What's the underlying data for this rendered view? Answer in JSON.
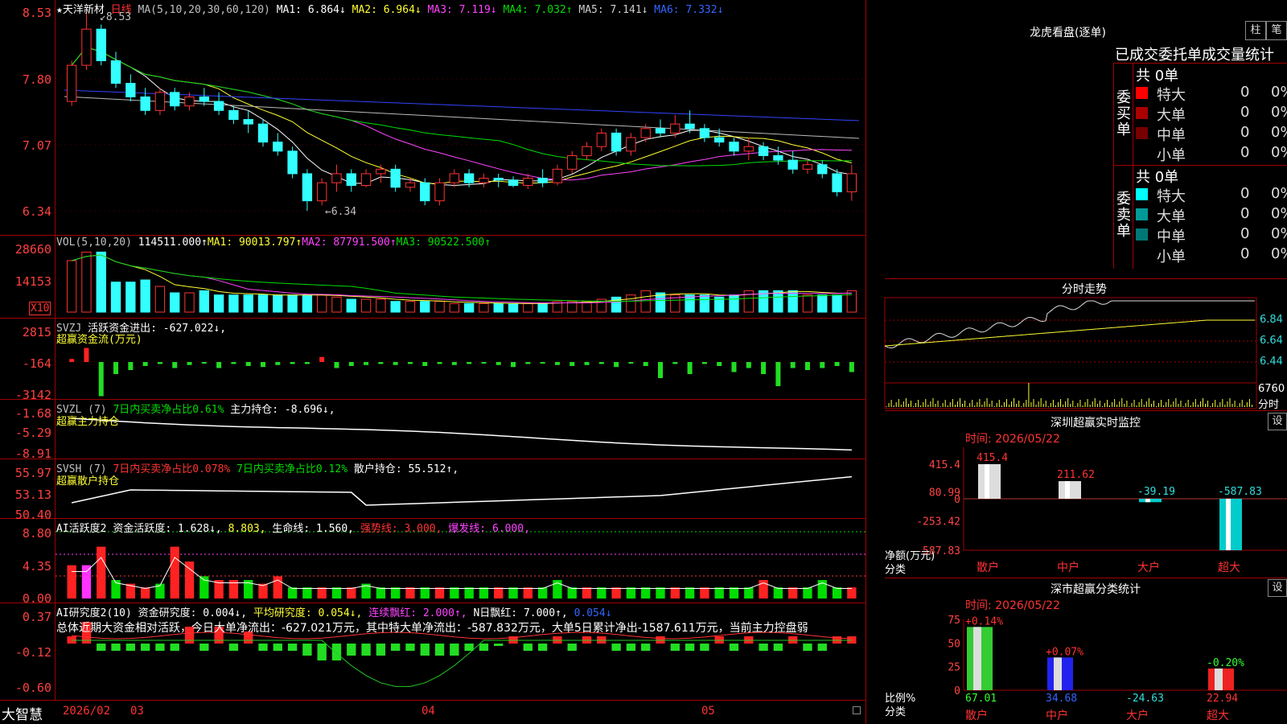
{
  "stock": {
    "name_label": "★天洋新材",
    "period": "日线"
  },
  "main_ma": {
    "title": "MA(5,10,20,30,60,120)",
    "items": [
      {
        "t": "MA1: 6.864↓",
        "c": "#ffffff"
      },
      {
        "t": "MA2: 6.964↓",
        "c": "#ffff33"
      },
      {
        "t": "MA3: 7.119↓",
        "c": "#ff44ff"
      },
      {
        "t": "MA4: 7.032↑",
        "c": "#00dd00"
      },
      {
        "t": "MA5: 7.141↓",
        "c": "#cccccc"
      },
      {
        "t": "MA6: 7.332↓",
        "c": "#3366ff"
      }
    ]
  },
  "main_axis": [
    "8.53",
    "7.80",
    "7.07",
    "6.34"
  ],
  "high_note": "8.53",
  "low_note": "←6.34",
  "vol": {
    "title": "VOL(5,10,20)",
    "v": "114511.000↑",
    "ma1": "MA1: 90013.797↑",
    "ma2": "MA2: 87791.500↑",
    "ma3": "MA3: 90522.500↑",
    "axis": [
      "28660",
      "14153"
    ],
    "unit": "X10"
  },
  "svzj": {
    "title": "SVZJ",
    "label": "活跃资金进出: -627.022↓,",
    "sub": "超赢资金流(万元)",
    "axis": [
      "2815",
      "-164",
      "-3142"
    ]
  },
  "svzl": {
    "title": "SVZL (7)",
    "a": "7日内买卖净占比0.61%",
    "b": "主力持仓: -8.696↓,",
    "sub": "超赢主力持仓",
    "axis": [
      "-1.68",
      "-5.29",
      "-8.91"
    ]
  },
  "svsh": {
    "title": "SVSH (7)",
    "a": "7日内买卖净占比0.078%",
    "b": "7日内买卖净占比0.12%",
    "c": "散户持仓: 55.512↑,",
    "sub": "超赢散户持仓",
    "axis": [
      "55.97",
      "53.13",
      "50.40"
    ]
  },
  "ai1": {
    "title": "AI活跃度2",
    "a": "资金活跃度: 1.628↓,",
    "b": "8.803,",
    "c": "生命线: 1.560,",
    "d": "强势线: 3.000,",
    "e": "爆发线: 6.000,",
    "axis": [
      "8.80",
      "4.35",
      "0.00"
    ]
  },
  "ai2": {
    "title": "AI研究度2(10)",
    "a": "资金研究度: 0.004↓,",
    "b": "平均研究度: 0.054↓,",
    "c": "连续飘红: 2.000↑,",
    "d": "N日飘红: 7.000↑,",
    "e": "0.054↓",
    "summary": "总体近期大资金相对活跃，今日大单净流出：-627.021万元，其中特大单净流出：-587.832万元，大单5日累计净出-1587.611万元，当前主力控盘弱",
    "axis": [
      "0.37",
      "-0.12",
      "-0.60"
    ]
  },
  "xaxis": {
    "brand": "大智慧",
    "d1": "2026/02",
    "d2": "03",
    "d3": "04",
    "d4": "05"
  },
  "right": {
    "dragon_title": "龙虎看盘(逐单)",
    "btn1": "柱",
    "btn2": "笔",
    "tabs": "已成交委托单成交量统计",
    "buy_side": "委买单",
    "sell_side": "委卖单",
    "buy_total": "共 0单",
    "sell_total": "共 0单",
    "buy_rows": [
      {
        "name": "特大",
        "n": "0",
        "p": "0%",
        "c": "#ff0000"
      },
      {
        "name": "大单",
        "n": "0",
        "p": "0%",
        "c": "#aa0000"
      },
      {
        "name": "中单",
        "n": "0",
        "p": "0%",
        "c": "#770000"
      },
      {
        "name": "小单",
        "n": "0",
        "p": "0%",
        "c": "#000000"
      }
    ],
    "sell_rows": [
      {
        "name": "特大",
        "n": "0",
        "p": "0%",
        "c": "#00ffff"
      },
      {
        "name": "大单",
        "n": "0",
        "p": "0%",
        "c": "#009999"
      },
      {
        "name": "中单",
        "n": "0",
        "p": "0%",
        "c": "#007777"
      },
      {
        "name": "小单",
        "n": "0",
        "p": "0%",
        "c": "#000000"
      }
    ],
    "fenshi_title": "分时走势",
    "fenshi_axis": [
      "6.84",
      "6.64",
      "6.44",
      "6760"
    ],
    "fenshi_unit": "分时",
    "sz_title": "深圳超赢实时监控",
    "sz_btn": "设",
    "sz_time": "时间: 2026/05/22",
    "sz_axis": [
      "415.4",
      "80.99",
      "0",
      "-253.42",
      "-587.83"
    ],
    "sz_ylabel": "净额(万元)",
    "sz_xlabel": "分类",
    "sz_bars": [
      {
        "cat": "散户",
        "val": 415.4,
        "label": "415.4",
        "lc": "#ff3333"
      },
      {
        "cat": "中户",
        "val": 211.62,
        "label": "211.62",
        "lc": "#ff3333"
      },
      {
        "cat": "大户",
        "val": -39.19,
        "label": "-39.19",
        "lc": "#33dddd"
      },
      {
        "cat": "超大",
        "val": -587.83,
        "label": "-587.83",
        "lc": "#33dddd"
      }
    ],
    "fl_title": "深市超赢分类统计",
    "fl_btn": "设",
    "fl_time": "时间: 2026/05/22",
    "fl_axis": [
      "75",
      "50",
      "25",
      "0"
    ],
    "fl_ylabel": "比例%",
    "fl_xlabel": "分类",
    "fl_bars": [
      {
        "cat": "散户",
        "val": 67.01,
        "pct": "+0.14%",
        "pc": "#ff3333",
        "vc": "#33ff33",
        "color": "#33cc33"
      },
      {
        "cat": "中户",
        "val": 34.68,
        "pct": "+0.07%",
        "pc": "#ff3333",
        "vc": "#3366ff",
        "color": "#2222ee"
      },
      {
        "cat": "大户",
        "val": -24.63,
        "pct": "",
        "pc": "#ff3333",
        "vc": "#33dddd",
        "color": "#00cccc"
      },
      {
        "cat": "超大",
        "val": 22.94,
        "pct": "-0.20%",
        "pc": "#33ff33",
        "vc": "#ff3333",
        "color": "#ee2222"
      }
    ],
    "fl_values": [
      "67.01",
      "34.68",
      "-24.63",
      "22.94"
    ]
  },
  "series": {
    "ohlc": [
      [
        7.55,
        8.0,
        7.5,
        7.95
      ],
      [
        7.95,
        8.53,
        7.9,
        8.35
      ],
      [
        8.35,
        8.4,
        7.95,
        8.0
      ],
      [
        8.0,
        8.1,
        7.7,
        7.75
      ],
      [
        7.75,
        7.85,
        7.55,
        7.6
      ],
      [
        7.6,
        7.7,
        7.4,
        7.45
      ],
      [
        7.45,
        7.7,
        7.4,
        7.65
      ],
      [
        7.65,
        7.7,
        7.45,
        7.5
      ],
      [
        7.5,
        7.65,
        7.45,
        7.6
      ],
      [
        7.6,
        7.7,
        7.5,
        7.55
      ],
      [
        7.55,
        7.65,
        7.4,
        7.45
      ],
      [
        7.45,
        7.5,
        7.3,
        7.35
      ],
      [
        7.35,
        7.45,
        7.2,
        7.3
      ],
      [
        7.3,
        7.35,
        7.05,
        7.1
      ],
      [
        7.1,
        7.2,
        6.95,
        7.0
      ],
      [
        7.0,
        7.05,
        6.7,
        6.75
      ],
      [
        6.75,
        6.8,
        6.34,
        6.45
      ],
      [
        6.45,
        6.7,
        6.4,
        6.65
      ],
      [
        6.65,
        6.85,
        6.55,
        6.75
      ],
      [
        6.75,
        6.8,
        6.55,
        6.62
      ],
      [
        6.62,
        6.8,
        6.6,
        6.75
      ],
      [
        6.75,
        6.85,
        6.65,
        6.8
      ],
      [
        6.8,
        6.85,
        6.55,
        6.6
      ],
      [
        6.6,
        6.7,
        6.55,
        6.65
      ],
      [
        6.65,
        6.7,
        6.4,
        6.45
      ],
      [
        6.45,
        6.7,
        6.4,
        6.65
      ],
      [
        6.65,
        6.8,
        6.6,
        6.75
      ],
      [
        6.75,
        6.8,
        6.6,
        6.65
      ],
      [
        6.65,
        6.75,
        6.6,
        6.7
      ],
      [
        6.7,
        6.75,
        6.6,
        6.68
      ],
      [
        6.68,
        6.72,
        6.6,
        6.62
      ],
      [
        6.62,
        6.75,
        6.58,
        6.7
      ],
      [
        6.7,
        6.8,
        6.6,
        6.65
      ],
      [
        6.65,
        6.85,
        6.62,
        6.8
      ],
      [
        6.8,
        7.0,
        6.75,
        6.95
      ],
      [
        6.95,
        7.1,
        6.9,
        7.05
      ],
      [
        7.05,
        7.25,
        7.0,
        7.2
      ],
      [
        7.2,
        7.25,
        6.95,
        7.0
      ],
      [
        7.0,
        7.2,
        6.95,
        7.15
      ],
      [
        7.15,
        7.3,
        7.1,
        7.25
      ],
      [
        7.25,
        7.35,
        7.15,
        7.2
      ],
      [
        7.2,
        7.4,
        7.15,
        7.3
      ],
      [
        7.3,
        7.45,
        7.2,
        7.25
      ],
      [
        7.25,
        7.3,
        7.1,
        7.15
      ],
      [
        7.15,
        7.25,
        7.05,
        7.1
      ],
      [
        7.1,
        7.15,
        6.95,
        7.0
      ],
      [
        7.0,
        7.15,
        6.9,
        7.05
      ],
      [
        7.05,
        7.1,
        6.9,
        6.95
      ],
      [
        6.95,
        7.05,
        6.85,
        6.9
      ],
      [
        6.9,
        7.0,
        6.75,
        6.8
      ],
      [
        6.8,
        6.9,
        6.75,
        6.85
      ],
      [
        6.85,
        6.9,
        6.7,
        6.75
      ],
      [
        6.75,
        6.8,
        6.5,
        6.55
      ],
      [
        6.55,
        6.85,
        6.45,
        6.75
      ]
    ],
    "vol": [
      24,
      28,
      28,
      14,
      14,
      15,
      12,
      9,
      9,
      10,
      8,
      8,
      8,
      8,
      8,
      8,
      8,
      8,
      7,
      6,
      6,
      6,
      5,
      5,
      5,
      5,
      4,
      4,
      4,
      4,
      4,
      4,
      4,
      5,
      5,
      5,
      6,
      7,
      8,
      10,
      9,
      8,
      8,
      8,
      7,
      8,
      10,
      10,
      10,
      10,
      8,
      8,
      8,
      10
    ],
    "flow": [
      15,
      70,
      -170,
      -60,
      -40,
      -20,
      -10,
      -30,
      -15,
      -5,
      -30,
      -10,
      -20,
      -25,
      -15,
      -10,
      -10,
      25,
      -30,
      -20,
      -15,
      -10,
      -15,
      -10,
      -20,
      -10,
      -15,
      -10,
      -5,
      -15,
      -25,
      -10,
      -5,
      -15,
      -20,
      -15,
      -10,
      -25,
      -5,
      -20,
      -80,
      -10,
      -60,
      -10,
      -20,
      -50,
      -30,
      -60,
      -120,
      -30,
      -40,
      -30,
      -20,
      -50
    ],
    "fund": [
      9,
      9,
      14,
      5,
      4,
      3,
      4,
      14,
      10,
      6,
      5,
      5,
      5,
      4,
      6,
      3,
      3,
      3,
      3,
      3,
      4,
      3,
      3,
      3,
      3,
      3,
      3,
      3,
      3,
      3,
      3,
      3,
      3,
      5,
      3,
      3,
      3,
      3,
      3,
      3,
      3,
      3,
      3,
      3,
      3,
      3,
      3,
      5,
      3,
      3,
      3,
      5,
      3,
      3
    ],
    "ai2": [
      1,
      4,
      -1,
      -1,
      -1,
      -1,
      -1,
      -1,
      3,
      -1,
      3,
      -1,
      2,
      -1,
      -1,
      -1,
      -2,
      -3,
      -3,
      -2,
      -2,
      -2,
      -1,
      -1,
      -2,
      -2,
      -2,
      -1,
      -1,
      0,
      1,
      -1,
      -1,
      1,
      -1,
      1,
      1,
      -1,
      -1,
      -1,
      1,
      -1,
      -1,
      -1,
      1,
      -1,
      1,
      -1,
      -1,
      1,
      -1,
      -1,
      1,
      1
    ]
  }
}
